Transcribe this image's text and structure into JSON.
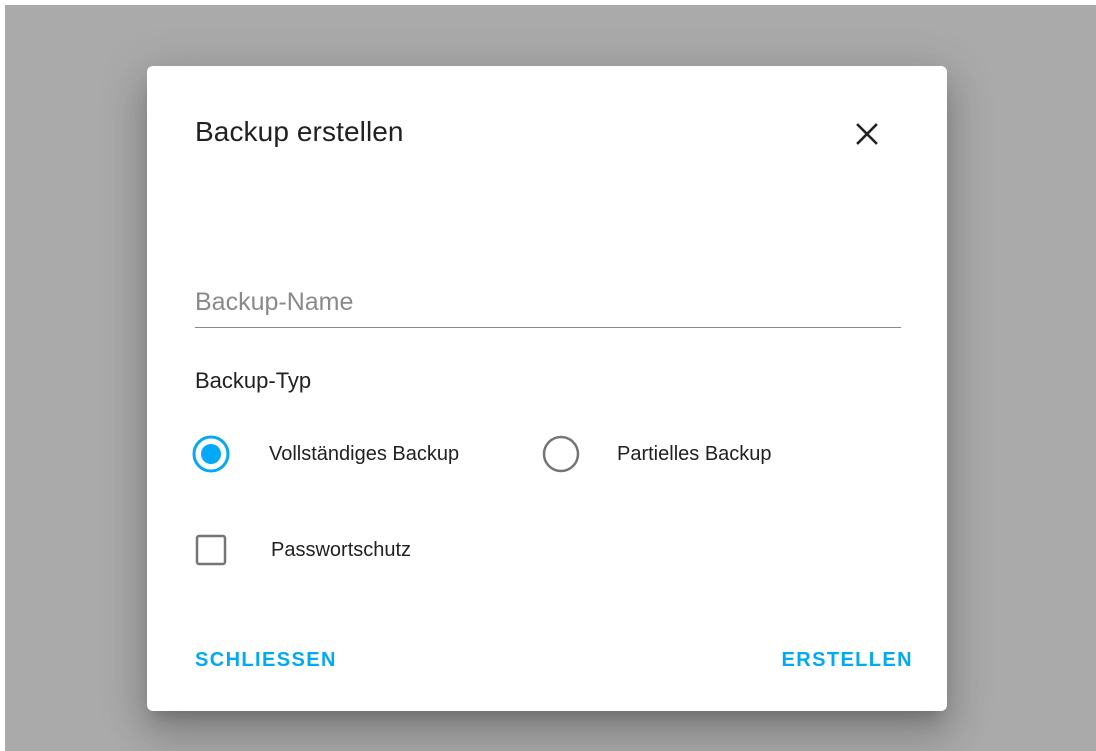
{
  "dialog": {
    "title": "Backup erstellen",
    "close_icon": "close-icon",
    "name_field": {
      "placeholder": "Backup-Name",
      "value": ""
    },
    "type_section": {
      "label": "Backup-Typ",
      "options": [
        {
          "label": "Vollständiges Backup",
          "selected": true
        },
        {
          "label": "Partielles Backup",
          "selected": false
        }
      ]
    },
    "password_protection": {
      "label": "Passwortschutz",
      "checked": false
    },
    "actions": {
      "close_label": "SCHLIESSEN",
      "create_label": "ERSTELLEN"
    },
    "colors": {
      "accent": "#03a9f4",
      "text": "#212121",
      "muted": "#757575",
      "backdrop": "#aaaaaa"
    }
  }
}
